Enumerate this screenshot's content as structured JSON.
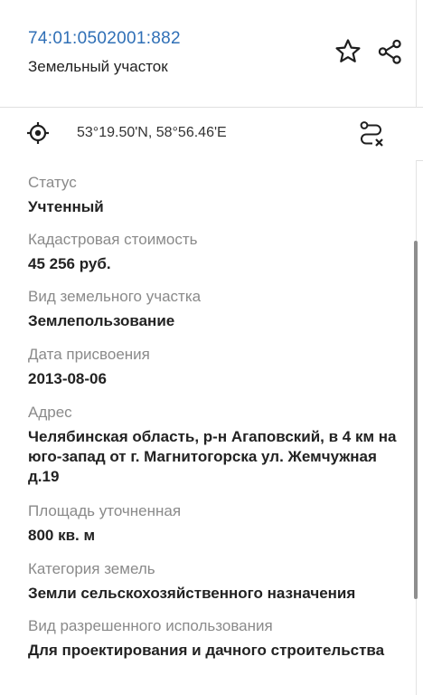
{
  "header": {
    "cadastral_number": "74:01:0502001:882",
    "object_type": "Земельный участок",
    "favorite_icon": "star-outline-icon",
    "share_icon": "share-icon"
  },
  "location": {
    "coordinates": "53°19.50'N, 58°56.46'E",
    "locate_icon": "crosshair-target-icon",
    "route_icon": "route-clear-icon"
  },
  "attributes": [
    {
      "label": "Статус",
      "value": "Учтенный"
    },
    {
      "label": "Кадастровая стоимость",
      "value": "45 256 руб."
    },
    {
      "label": "Вид земельного участка",
      "value": "Землепользование"
    },
    {
      "label": "Дата присвоения",
      "value": "2013-08-06"
    },
    {
      "label": "Адрес",
      "value": "Челябинская область, р-н Агаповский,  в 4 км на юго-запад от г. Магнитогорска ул. Жемчужная д.19"
    },
    {
      "label": "Площадь уточненная",
      "value": "800 кв. м"
    },
    {
      "label": "Категория земель",
      "value": "Земли сельскохозяйственного назначения"
    },
    {
      "label": "Вид разрешенного использования",
      "value": "Для проектирования и дачного строительства"
    }
  ],
  "colors": {
    "link": "#2f6fb6",
    "label": "#8a8a8a",
    "value": "#222222"
  }
}
